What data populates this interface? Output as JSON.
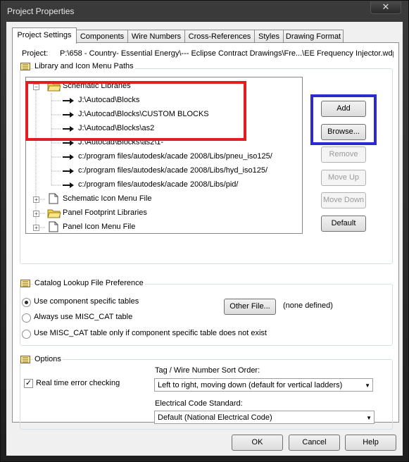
{
  "window": {
    "title": "Project Properties",
    "close_symbol": "✕"
  },
  "tabs": [
    {
      "label": "Project Settings"
    },
    {
      "label": "Components"
    },
    {
      "label": "Wire Numbers"
    },
    {
      "label": "Cross-References"
    },
    {
      "label": "Styles"
    },
    {
      "label": "Drawing Format"
    }
  ],
  "project": {
    "label": "Project:",
    "path": "P:\\658 - Country- Essential Energy\\--- Eclipse Contract Drawings\\Fre...\\EE Frequency Injector.wdp"
  },
  "library_group": {
    "title": "Library and Icon Menu Paths",
    "tree": {
      "schematic_libraries": "Schematic Libraries",
      "paths": [
        "J:\\Autocad\\Blocks",
        "J:\\Autocad\\Blocks\\CUSTOM BLOCKS",
        "J:\\Autocad\\Blocks\\as2",
        "J:\\Autocad\\Blocks\\as2\\1-",
        "c:/program files/autodesk/acade 2008/Libs/pneu_iso125/",
        "c:/program files/autodesk/acade 2008/Libs/hyd_iso125/",
        "c:/program files/autodesk/acade 2008/Libs/pid/"
      ],
      "schematic_icon_menu_file": "Schematic Icon Menu File",
      "panel_footprint_libraries": "Panel Footprint Libraries",
      "panel_icon_menu_file": "Panel Icon Menu File"
    },
    "buttons": {
      "add": "Add",
      "browse": "Browse...",
      "remove": "Remove",
      "move_up": "Move Up",
      "move_down": "Move Down",
      "default": "Default"
    }
  },
  "catalog_group": {
    "title": "Catalog Lookup File Preference",
    "options": [
      {
        "label": "Use component specific tables",
        "selected": true
      },
      {
        "label": "Always use MISC_CAT table",
        "selected": false
      },
      {
        "label": "Use MISC_CAT table only if component specific table does not exist",
        "selected": false
      }
    ],
    "other_file_button": "Other File...",
    "other_file_value": "(none defined)"
  },
  "options_group": {
    "title": "Options",
    "realtime_error_checking": {
      "label": "Real time error checking",
      "checked": true,
      "mark": "✓"
    },
    "sort_order": {
      "label": "Tag / Wire Number Sort Order:",
      "value": "Left to right, moving down (default for vertical ladders)"
    },
    "electrical_code": {
      "label": "Electrical Code Standard:",
      "value": "Default (National Electrical Code)"
    }
  },
  "footer": {
    "ok": "OK",
    "cancel": "Cancel",
    "help": "Help"
  },
  "colors": {
    "highlight_red": "#e21d24",
    "highlight_blue": "#2b2bcc"
  }
}
